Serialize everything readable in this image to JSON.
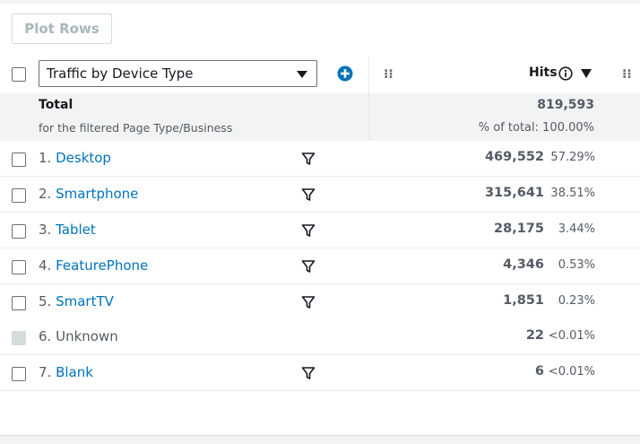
{
  "toolbar": {
    "plot_rows_label": "Plot Rows"
  },
  "header": {
    "dimension_value": "Traffic by Device Type",
    "metric_label": "Hits"
  },
  "total": {
    "title": "Total",
    "subtitle": "for the filtered Page Type/Business",
    "value": "819,593",
    "pct": "% of total: 100.00%"
  },
  "rows": [
    {
      "index": "1.",
      "label": "Desktop",
      "hits": "469,552",
      "pct": "57.29%"
    },
    {
      "index": "2.",
      "label": "Smartphone",
      "hits": "315,641",
      "pct": "38.51%"
    },
    {
      "index": "3.",
      "label": "Tablet",
      "hits": "28,175",
      "pct": "3.44%"
    },
    {
      "index": "4.",
      "label": "FeaturePhone",
      "hits": "4,346",
      "pct": "0.53%"
    },
    {
      "index": "5.",
      "label": "SmartTV",
      "hits": "1,851",
      "pct": "0.23%"
    },
    {
      "index": "6.",
      "label": "Unknown",
      "hits": "22",
      "pct": "<0.01%"
    },
    {
      "index": "7.",
      "label": "Blank",
      "hits": "6",
      "pct": "<0.01%"
    }
  ],
  "colors": {
    "link": "#0073bb",
    "accent_icon": "#0073bb",
    "header_bg": "#f2f3f3"
  }
}
